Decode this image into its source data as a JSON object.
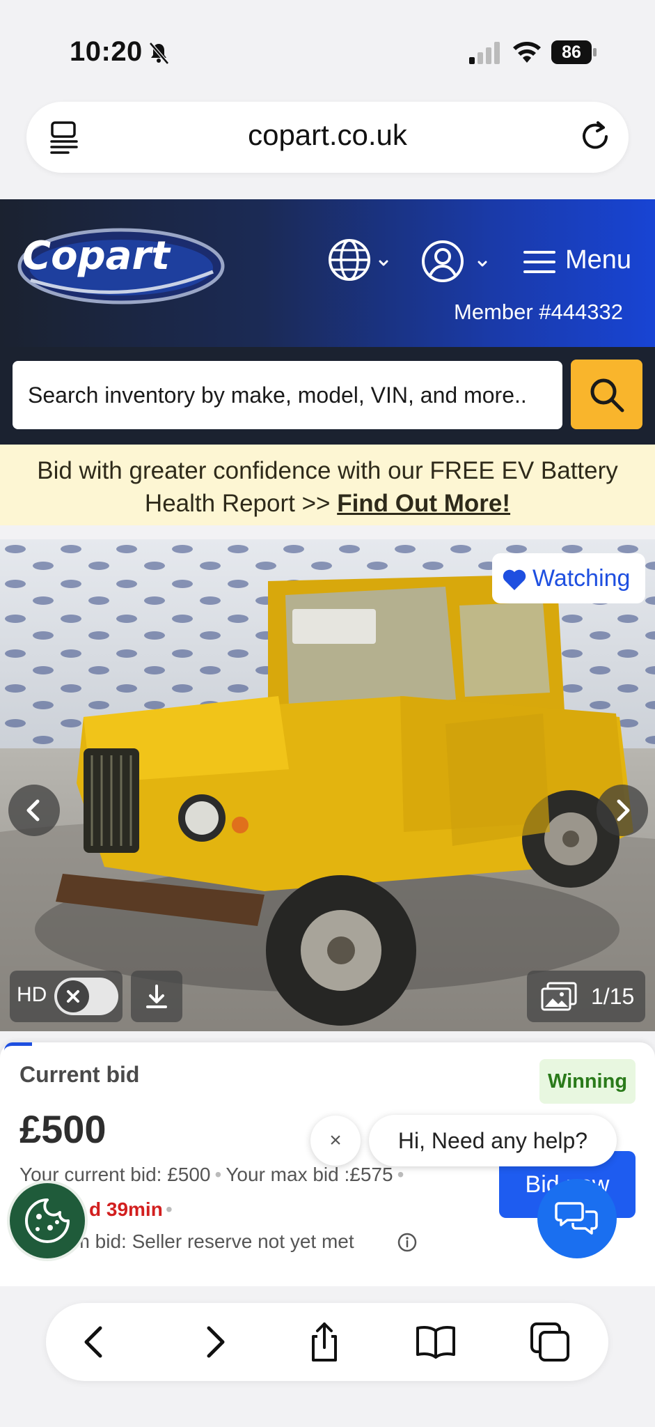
{
  "status_bar": {
    "time": "10:20",
    "battery": "86"
  },
  "browser": {
    "url": "copart.co.uk"
  },
  "header": {
    "logo_text": "Copart",
    "menu_label": "Menu",
    "member_text": "Member  #444332"
  },
  "search": {
    "placeholder": "Search inventory by make, model, VIN, and more.."
  },
  "banner": {
    "text_line": "Bid with greater confidence with our FREE EV Battery Health Report >> ",
    "link_label": "Find Out More!"
  },
  "gallery": {
    "watch_label": "Watching",
    "hd_label": "HD",
    "image_counter": "1/15"
  },
  "bid": {
    "current_bid_label": "Current bid",
    "amount": "£500",
    "status_badge": "Winning",
    "your_current_bid": "Your current bid: £500",
    "your_max_bid": "Your max bid :£575",
    "time_left": "d 39min",
    "reserve_text": "um bid:  Seller reserve not yet met",
    "bid_now_label": "Bid now"
  },
  "chat": {
    "close_symbol": "×",
    "bubble_text": "Hi, Need any help?"
  },
  "colors": {
    "accent_blue": "#1e5cf0",
    "search_button": "#f9b52c",
    "banner_bg": "#fdf6d3",
    "winning_text": "#2a7a1a",
    "time_left_red": "#d21f1f"
  },
  "icons": [
    "bell-slash-icon",
    "signal-icon",
    "wifi-icon",
    "battery-icon",
    "tabs-icon",
    "reload-icon",
    "globe-icon",
    "user-icon",
    "hamburger-icon",
    "search-icon",
    "heart-icon",
    "chevron-left-icon",
    "chevron-right-icon",
    "close-icon",
    "download-icon",
    "gallery-icon",
    "info-icon",
    "chat-icon",
    "cookie-icon",
    "back-icon",
    "forward-icon",
    "share-icon",
    "bookmarks-icon",
    "tabs-overview-icon"
  ]
}
